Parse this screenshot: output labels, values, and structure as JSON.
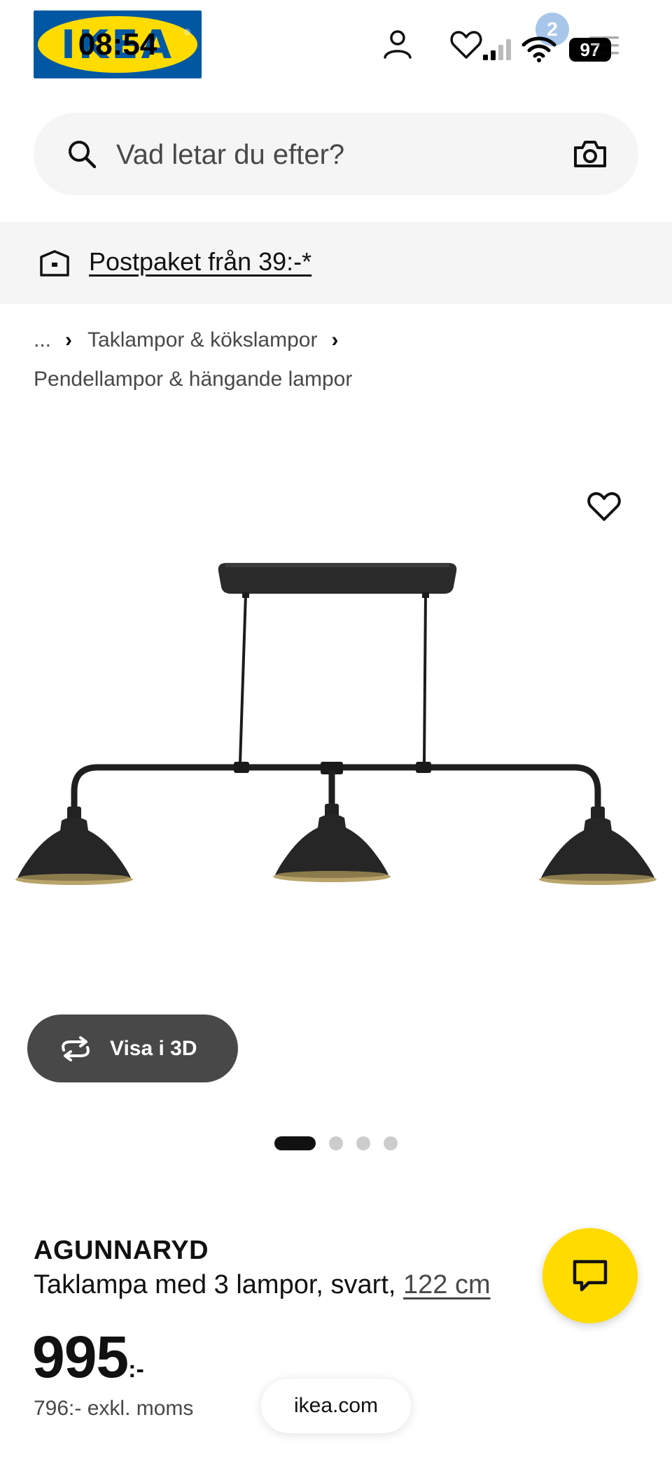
{
  "status_bar": {
    "time": "08:54",
    "battery": "97",
    "cart_count": "2"
  },
  "header": {
    "logo_text": "IKEA",
    "logo_colors": {
      "blue": "#0058a3",
      "yellow": "#ffdb00"
    },
    "icons": [
      "user-icon",
      "heart-icon",
      "cart-icon",
      "menu-icon"
    ]
  },
  "search": {
    "placeholder": "Vad letar du efter?",
    "icons": [
      "search-icon",
      "camera-icon"
    ]
  },
  "promo": {
    "text": "Postpaket från 39:-*",
    "icon": "parcel-icon"
  },
  "breadcrumb": {
    "ellipsis": "...",
    "level1": "Taklampor & kökslampor",
    "level2": "Pendellampor & hängande lampor"
  },
  "gallery": {
    "view_3d_label": "Visa i 3D",
    "slide_count": 4,
    "active_slide": 1
  },
  "product": {
    "name": "AGUNNARYD",
    "description": "Taklampa med 3 lampor, svart,",
    "size": "122 cm",
    "price": "995",
    "price_suffix": ":-",
    "price_excl_vat": "796:- exkl. moms"
  },
  "browser": {
    "url": "ikea.com"
  },
  "colors": {
    "accent_yellow": "#ffdb00",
    "dark_button": "#484848",
    "muted_bg": "#f5f5f5"
  }
}
